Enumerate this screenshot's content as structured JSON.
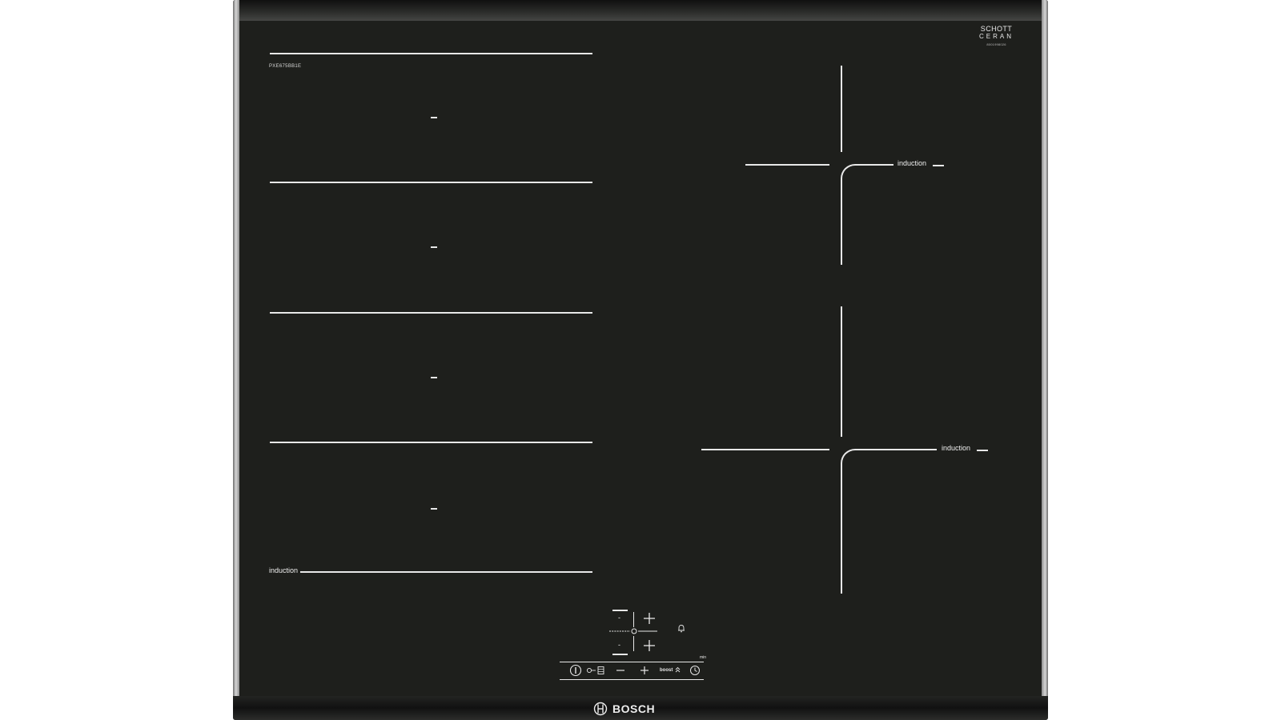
{
  "model": "PXE675BB1E",
  "zone_label": "induction",
  "brand": {
    "schott_line1": "SCHOTT",
    "schott_line2": "CERAN",
    "schott_code": "8001998026",
    "bosch": "BOSCH"
  },
  "controls": {
    "minus": "-",
    "timer_unit": "min",
    "boost": "boost",
    "icons": [
      "power-icon",
      "lock-icon",
      "minus-icon",
      "plus-icon",
      "boost-icon",
      "timer-icon",
      "bell-icon",
      "target-icon"
    ]
  },
  "colors": {
    "glass": "#1e1f1c",
    "markings": "#e8e8e8",
    "frame": "#b0b0b0"
  }
}
